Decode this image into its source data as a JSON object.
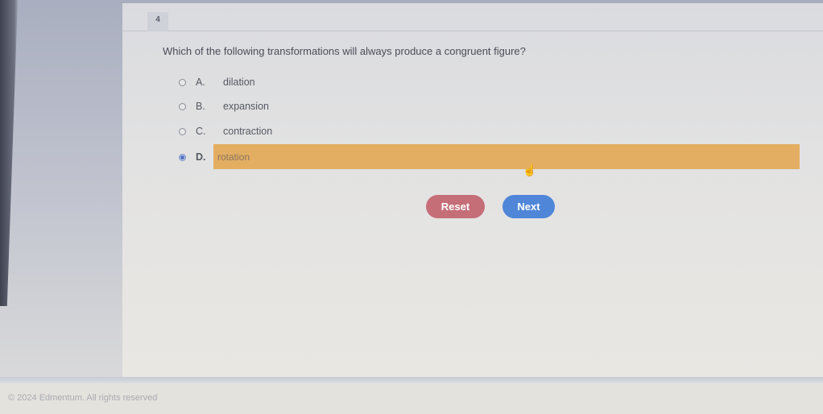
{
  "question": {
    "number": "4",
    "text": "Which of the following transformations will always produce a congruent figure?",
    "options": [
      {
        "letter": "A.",
        "text": "dilation",
        "selected": false
      },
      {
        "letter": "B.",
        "text": "expansion",
        "selected": false
      },
      {
        "letter": "C.",
        "text": "contraction",
        "selected": false
      },
      {
        "letter": "D.",
        "text": "rotation",
        "selected": true
      }
    ]
  },
  "buttons": {
    "reset": "Reset",
    "next": "Next"
  },
  "colors": {
    "selected_highlight": "#e3ae62",
    "reset": "#c56e78",
    "next": "#4f86d8"
  },
  "footer": {
    "copyright": "© 2024 Edmentum. All rights reserved"
  },
  "icons": {
    "cursor": "hand-pointer-icon"
  }
}
